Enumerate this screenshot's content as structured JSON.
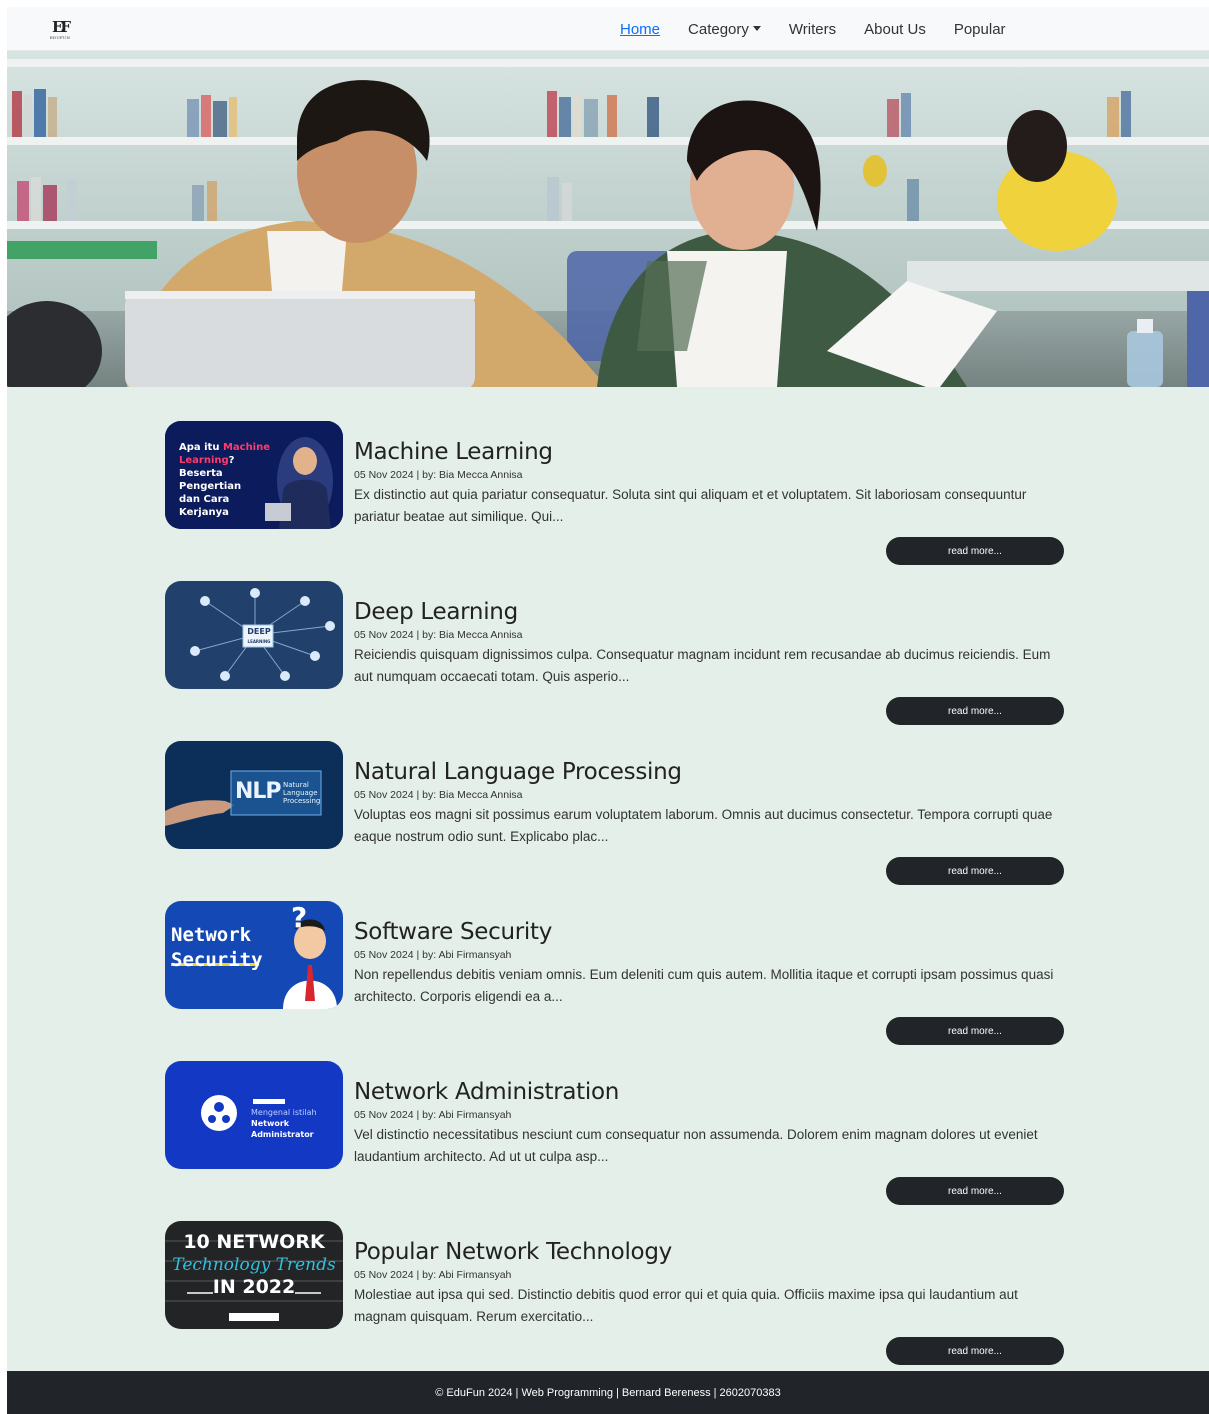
{
  "brand": {
    "logo_glyph": "EF",
    "logo_text": "EDUFUN"
  },
  "nav": {
    "home": "Home",
    "category": "Category",
    "writers": "Writers",
    "about": "About Us",
    "popular": "Popular"
  },
  "articles": [
    {
      "title": "Machine Learning",
      "meta": "05 Nov 2024 | by: Bia Mecca Annisa",
      "excerpt": "Ex distinctio aut quia pariatur consequatur. Soluta sint qui aliquam et et voluptatem. Sit laboriosam consequuntur pariatur beatae aut similique. Qui...",
      "read_more": "read more...",
      "thumb_text": [
        "Apa itu ",
        "Machine",
        "Learning",
        "?",
        "Beserta Pengertian",
        "dan Cara Kerjanya"
      ]
    },
    {
      "title": "Deep Learning",
      "meta": "05 Nov 2024 | by: Bia Mecca Annisa",
      "excerpt": "Reiciendis quisquam dignissimos culpa. Consequatur magnam incidunt rem recusandae ab ducimus reiciendis. Eum aut numquam occaecati totam. Quis asperio...",
      "read_more": "read more...",
      "thumb_text": [
        "DEEP",
        "LEARNING"
      ]
    },
    {
      "title": "Natural Language Processing",
      "meta": "05 Nov 2024 | by: Bia Mecca Annisa",
      "excerpt": "Voluptas eos magni sit possimus earum voluptatem laborum. Omnis aut ducimus consectetur. Tempora corrupti quae eaque nostrum odio sunt. Explicabo plac...",
      "read_more": "read more...",
      "thumb_text": [
        "NLP",
        "Natural",
        "Language",
        "Processing"
      ]
    },
    {
      "title": "Software Security",
      "meta": "05 Nov 2024 | by: Abi Firmansyah",
      "excerpt": "Non repellendus debitis veniam omnis. Eum deleniti cum quis autem. Mollitia itaque et corrupti ipsam possimus quasi architecto. Corporis eligendi ea a...",
      "read_more": "read more...",
      "thumb_text": [
        "Network",
        "Security"
      ]
    },
    {
      "title": "Network Administration",
      "meta": "05 Nov 2024 | by: Abi Firmansyah",
      "excerpt": "Vel distinctio necessitatibus nesciunt cum consequatur non assumenda. Dolorem enim magnam dolores ut eveniet laudantium architecto. Ad ut ut culpa asp...",
      "read_more": "read more...",
      "thumb_text": [
        "Mengenal istilah",
        "Network Administrator"
      ]
    },
    {
      "title": "Popular Network Technology",
      "meta": "05 Nov 2024 | by: Abi Firmansyah",
      "excerpt": "Molestiae aut ipsa qui sed. Distinctio debitis quod error qui et quia quia. Officiis maxime ipsa qui laudantium aut magnam quisquam. Rerum exercitatio...",
      "read_more": "read more...",
      "thumb_text": [
        "10 NETWORK",
        "Technology Trends",
        "IN 2022"
      ]
    }
  ],
  "footer": {
    "text": "© EduFun 2024 | Web Programming | Bernard Bereness | 2602070383"
  }
}
